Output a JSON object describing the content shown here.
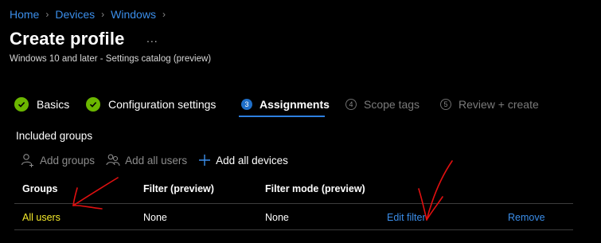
{
  "breadcrumb": [
    "Home",
    "Devices",
    "Windows"
  ],
  "page": {
    "title": "Create profile",
    "more_label": "...",
    "subtitle": "Windows 10 and later - Settings catalog (preview)"
  },
  "steps": [
    {
      "number": "",
      "label": "Basics",
      "state": "complete"
    },
    {
      "number": "",
      "label": "Configuration settings",
      "state": "complete"
    },
    {
      "number": "3",
      "label": "Assignments",
      "state": "active"
    },
    {
      "number": "4",
      "label": "Scope tags",
      "state": "upcoming"
    },
    {
      "number": "5",
      "label": "Review + create",
      "state": "upcoming"
    }
  ],
  "included_groups": {
    "heading": "Included groups",
    "actions": [
      {
        "label": "Add groups",
        "icon": "person-add-icon",
        "enabled": false
      },
      {
        "label": "Add all users",
        "icon": "people-icon",
        "enabled": false
      },
      {
        "label": "Add all devices",
        "icon": "plus-icon",
        "enabled": true
      }
    ],
    "columns": [
      "Groups",
      "Filter (preview)",
      "Filter mode (preview)"
    ],
    "rows": [
      {
        "group": "All users",
        "filter": "None",
        "filter_mode": "None",
        "edit_label": "Edit filter",
        "remove_label": "Remove"
      }
    ]
  },
  "colors": {
    "link": "#3b8eea",
    "success": "#6bb700",
    "accent": "#2d7fe0",
    "highlight": "#f4ea2a",
    "annotation": "#e01010"
  }
}
